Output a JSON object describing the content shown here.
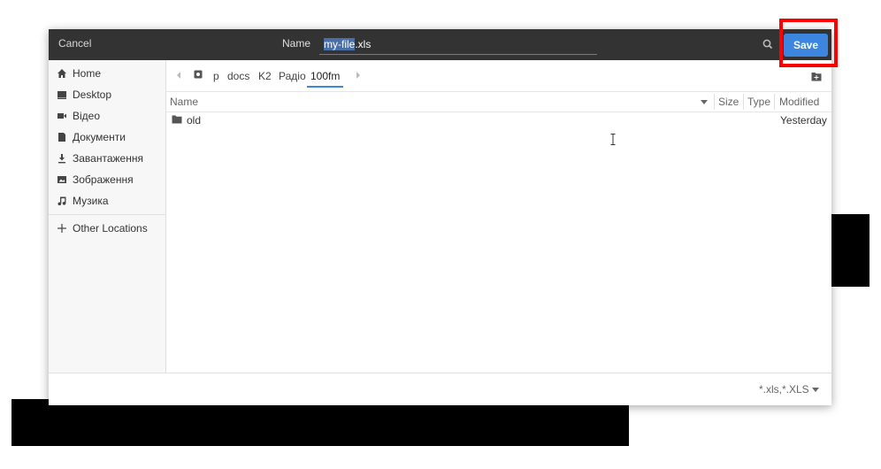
{
  "header": {
    "cancel_label": "Cancel",
    "name_label": "Name",
    "filename_selected": "my-file",
    "filename_ext": ".xls",
    "save_label": "Save"
  },
  "sidebar": {
    "items": [
      {
        "label": "Home",
        "icon": "home-icon"
      },
      {
        "label": "Desktop",
        "icon": "desktop-icon"
      },
      {
        "label": "Відео",
        "icon": "video-icon"
      },
      {
        "label": "Документи",
        "icon": "document-icon"
      },
      {
        "label": "Завантаження",
        "icon": "download-icon"
      },
      {
        "label": "Зображення",
        "icon": "image-icon"
      },
      {
        "label": "Музика",
        "icon": "music-icon"
      }
    ],
    "other_locations": {
      "label": "Other Locations",
      "icon": "plus-icon"
    }
  },
  "pathbar": {
    "crumbs": [
      "p",
      "docs",
      "K2",
      "Радіо",
      "100fm"
    ],
    "active_index": 4
  },
  "columns": {
    "name": "Name",
    "size": "Size",
    "type": "Type",
    "modified": "Modified"
  },
  "files": [
    {
      "name": "old",
      "size": "",
      "type": "",
      "modified": "Yesterday",
      "icon": "folder-icon"
    }
  ],
  "footer": {
    "filter_label": "*.xls,*.XLS"
  },
  "colors": {
    "header_bg": "#333333",
    "accent": "#3d86e0",
    "highlight": "#ff0000"
  }
}
